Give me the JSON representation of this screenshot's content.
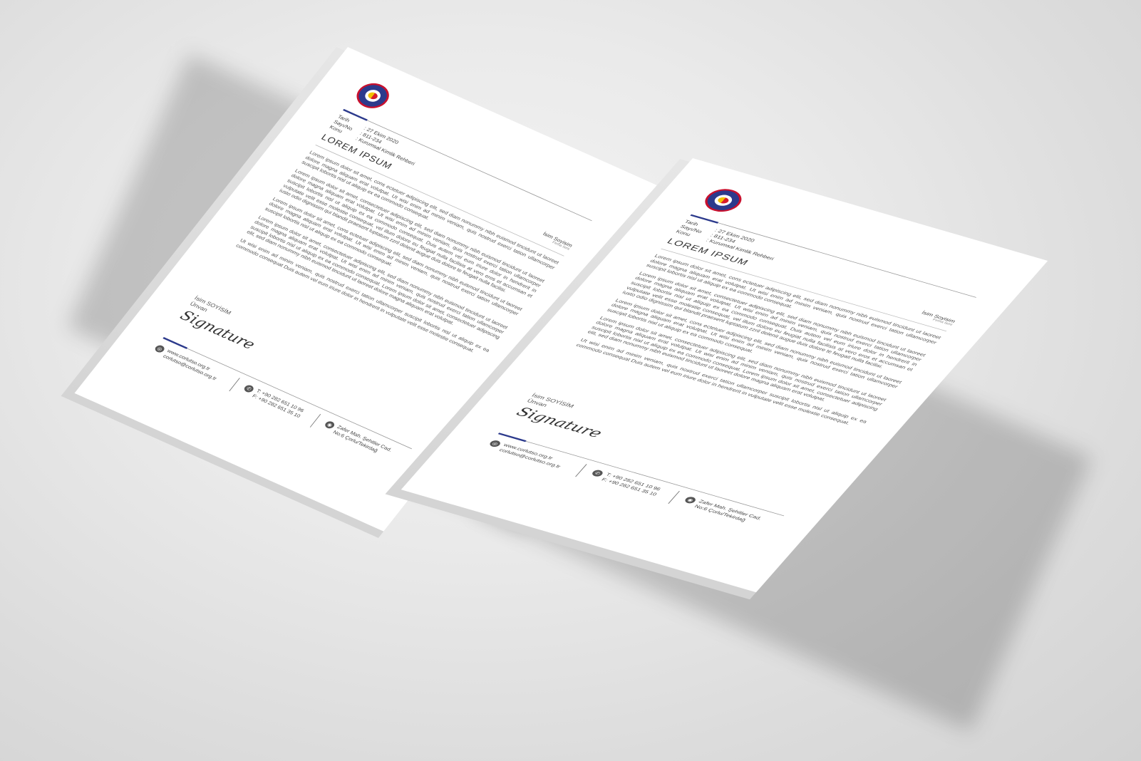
{
  "letterhead": {
    "meta": [
      {
        "label": "Tarih",
        "value": ": 27 Ekim 2020"
      },
      {
        "label": "Sayı/No",
        "value": ": 811-234"
      },
      {
        "label": "Konu",
        "value": ": Kurumsal Kimlik Rehberi"
      }
    ],
    "recipient_name": "İsim Soyisim",
    "recipient_title": "Firma İsmi",
    "title": "LOREM IPSUM",
    "paragraphs": [
      "Lorem ipsum dolor sit amet, cons ectetuer adipiscing elit, sed diam nonummy nibh euismod tincidunt ut laoreet dolore magna aliquam erat volutpat. Ut wisi enim ad minim veniam, quis nostrud exerci tation ullamcorper suscipit lobortis nisl ut aliquip ex ea commodo consequat.",
      "Lorem ipsum dolor sit amet, consectetuer adipiscing elit, sed diam nonummy nibh euismod tincidunt ut laoreet dolore magna aliquam erat volutpat. Ut wisi enim ad minim veniam, quis nostrud exerci tation ullamcorper suscipit lobortis nisl ut aliquip ex ea commodo consequat. Duis autem vel eum iriure dolor in hendrerit in vulputate velit esse molestie consequat, vel illum dolore eu feugiat nulla facilisis at vero eros et accumsan et iusto odio dignissim qui blandit praesent luptatum zzril delenit augue duis dolore te feugait nulla facilisi.",
      "Lorem ipsum dolor sit amet, cons ectetuer adipiscing elit, sed diam nonummy nibh euismod tincidunt ut laoreet dolore magna aliquam erat volutpat. Ut wisi enim ad minim veniam, quis nostrud exerci tation ullamcorper suscipit lobortis nisl ut aliquip ex ea commodo consequat.",
      "Lorem ipsum dolor sit amet, consectetuer adipiscing elit, sed diam nonummy nibh euismod tincidunt ut laoreet dolore magna aliquam erat volutpat. Ut wisi enim ad minim veniam, quis nostrud exerci tation ullamcorper suscipit lobortis nisl ut aliquip ex ea commodo consequat. Lorem ipsum dolor sit amet, consectetuer adipiscing elit, sed diam nonummy nibh euismod tincidunt ut laoreet dolore magna aliquam erat volutpat.",
      "Ut wisi enim ad minim veniam, quis nostrud exerci tation ullamcorper suscipit lobortis nisl ut aliquip ex ea commodo consequat Duis autem vel eum iriure dolor in hendrerit in vulputate velit esse molestie consequat."
    ],
    "sign_name": "İsim SOYİSİM",
    "sign_title": "Ünvan",
    "signature": "Signature",
    "web": "www.corlutso.org.tr",
    "email": "corlutso@corlutso.org.tr",
    "phone": "T: +90 282 651 10 96",
    "fax": "F: +90 282 651 35 10",
    "address_line1": "Zafer Mah. Şehitler Cad.",
    "address_line2": "No:6 Çorlu/Tekirdağ",
    "icons": [
      "globe-icon",
      "phone-icon",
      "location-pin-icon"
    ],
    "colors": {
      "accent": "#2c3a8c",
      "logo_ring": "#c8102e"
    }
  }
}
